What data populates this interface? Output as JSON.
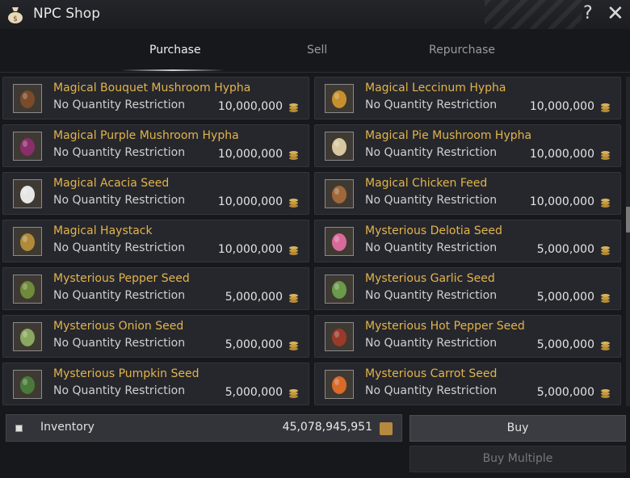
{
  "window": {
    "title": "NPC Shop",
    "help_label": "?",
    "close_label": "✕"
  },
  "tabs": [
    {
      "label": "Purchase",
      "active": true
    },
    {
      "label": "Sell",
      "active": false
    },
    {
      "label": "Repurchase",
      "active": false
    }
  ],
  "items": [
    {
      "name": "Magical Bouquet Mushroom Hypha",
      "restriction": "No Quantity Restriction",
      "price": "10,000,000",
      "icon": "mushroom-hypha-icon",
      "color": "#7a4a2a"
    },
    {
      "name": "Magical Leccinum Hypha",
      "restriction": "No Quantity Restriction",
      "price": "10,000,000",
      "icon": "leccinum-hypha-icon",
      "color": "#c8902c"
    },
    {
      "name": "Magical Purple Mushroom Hypha",
      "restriction": "No Quantity Restriction",
      "price": "10,000,000",
      "icon": "purple-mushroom-icon",
      "color": "#8a2e6a"
    },
    {
      "name": "Magical Pie Mushroom Hypha",
      "restriction": "No Quantity Restriction",
      "price": "10,000,000",
      "icon": "pie-mushroom-icon",
      "color": "#d8c7a0"
    },
    {
      "name": "Magical Acacia Seed",
      "restriction": "No Quantity Restriction",
      "price": "10,000,000",
      "icon": "acacia-seed-icon",
      "color": "#e6e6e6"
    },
    {
      "name": "Magical Chicken Feed",
      "restriction": "No Quantity Restriction",
      "price": "10,000,000",
      "icon": "chicken-feed-icon",
      "color": "#a0683a"
    },
    {
      "name": "Magical Haystack",
      "restriction": "No Quantity Restriction",
      "price": "10,000,000",
      "icon": "haystack-icon",
      "color": "#b08a3a"
    },
    {
      "name": "Mysterious Delotia Seed",
      "restriction": "No Quantity Restriction",
      "price": "5,000,000",
      "icon": "delotia-seed-icon",
      "color": "#d86a9a"
    },
    {
      "name": "Mysterious Pepper Seed",
      "restriction": "No Quantity Restriction",
      "price": "5,000,000",
      "icon": "pepper-seed-icon",
      "color": "#6e8a3a"
    },
    {
      "name": "Mysterious Garlic Seed",
      "restriction": "No Quantity Restriction",
      "price": "5,000,000",
      "icon": "garlic-seed-icon",
      "color": "#6a9a4a"
    },
    {
      "name": "Mysterious Onion Seed",
      "restriction": "No Quantity Restriction",
      "price": "5,000,000",
      "icon": "onion-seed-icon",
      "color": "#8aa860"
    },
    {
      "name": "Mysterious Hot Pepper Seed",
      "restriction": "No Quantity Restriction",
      "price": "5,000,000",
      "icon": "hot-pepper-seed-icon",
      "color": "#9a3a2a"
    },
    {
      "name": "Mysterious Pumpkin Seed",
      "restriction": "No Quantity Restriction",
      "price": "5,000,000",
      "icon": "pumpkin-seed-icon",
      "color": "#4a7a3a"
    },
    {
      "name": "Mysterious Carrot Seed",
      "restriction": "No Quantity Restriction",
      "price": "5,000,000",
      "icon": "carrot-seed-icon",
      "color": "#d86a2a"
    }
  ],
  "inventory": {
    "label": "Inventory",
    "value": "45,078,945,951"
  },
  "actions": {
    "buy_label": "Buy",
    "buy_multiple_label": "Buy Multiple"
  },
  "colors": {
    "item_name": "#e2b44a",
    "background": "#17181c",
    "card": "#26272d"
  }
}
